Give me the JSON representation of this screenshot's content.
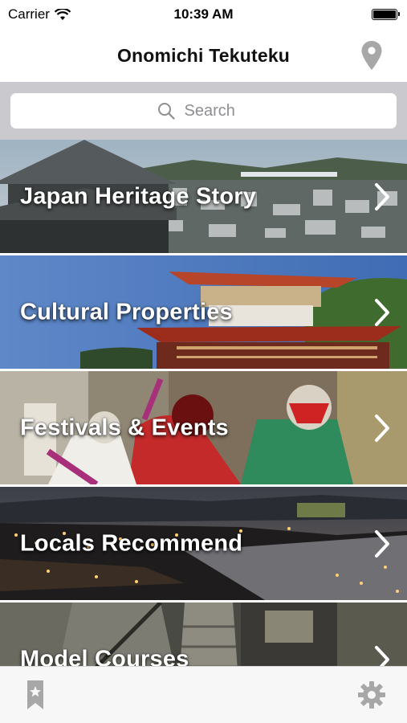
{
  "status_bar": {
    "carrier": "Carrier",
    "time": "10:39 AM"
  },
  "nav": {
    "title": "Onomichi Tekuteku",
    "map_icon": "location-pin-icon"
  },
  "search": {
    "placeholder": "Search",
    "icon": "search-icon"
  },
  "list": {
    "items": [
      {
        "label": "Japan Heritage Story"
      },
      {
        "label": "Cultural Properties"
      },
      {
        "label": "Festivals & Events"
      },
      {
        "label": "Locals Recommend"
      },
      {
        "label": "Model Courses"
      }
    ]
  },
  "tab_bar": {
    "left_icon": "bookmark-icon",
    "right_icon": "gear-icon"
  },
  "colors": {
    "tint_gray": "#a7a7a7",
    "search_bar_bg": "#c9c9ce",
    "label_white": "#ffffff"
  }
}
